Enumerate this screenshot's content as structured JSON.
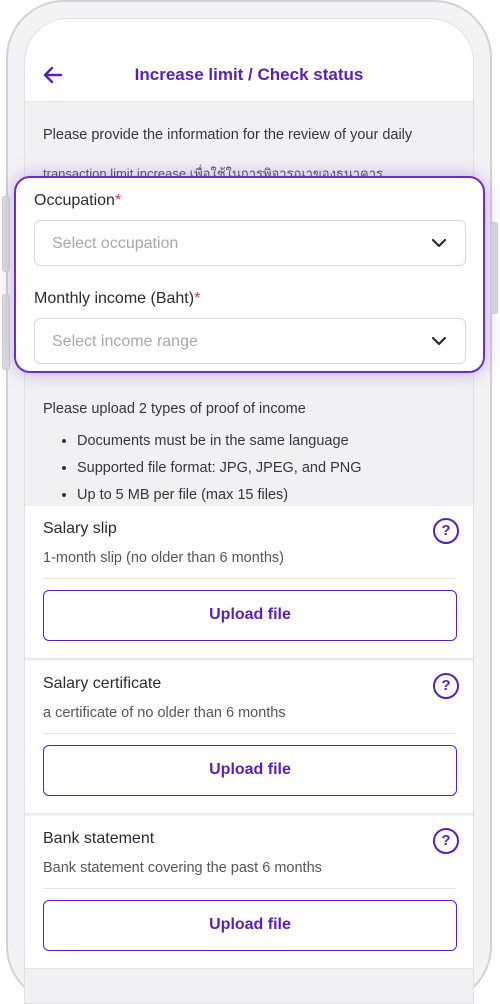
{
  "header": {
    "title": "Increase limit / Check status"
  },
  "intro": {
    "text": "Please provide the information for the review of your daily",
    "obscured_line": "transaction limit increase เพื่อใช้ในการพิจารณาของธนาคาร"
  },
  "form": {
    "occupation": {
      "label": "Occupation",
      "required_mark": "*",
      "placeholder": "Select occupation"
    },
    "income": {
      "label": "Monthly income (Baht)",
      "required_mark": "*",
      "placeholder": "Select income range"
    }
  },
  "proof": {
    "heading": "Please upload 2 types of proof of income",
    "bullets": [
      "Documents must be in the same language",
      "Supported file format: JPG, JPEG, and PNG",
      "Up to 5 MB per file (max 15 files)"
    ]
  },
  "documents": [
    {
      "title": "Salary slip",
      "description": "1-month slip (no older than 6 months)",
      "button": "Upload file",
      "help": "?"
    },
    {
      "title": "Salary certificate",
      "description": "a certificate of no older than 6 months",
      "button": "Upload file",
      "help": "?"
    },
    {
      "title": "Bank statement",
      "description": "Bank statement covering the past 6 months",
      "button": "Upload file",
      "help": "?"
    }
  ],
  "colors": {
    "brand": "#5a1fb5",
    "required": "#d0374c",
    "background": "#f1f1f3"
  },
  "icons": {
    "back": "arrow-left-icon",
    "dropdown": "chevron-down-icon",
    "help": "question-circle-icon"
  }
}
